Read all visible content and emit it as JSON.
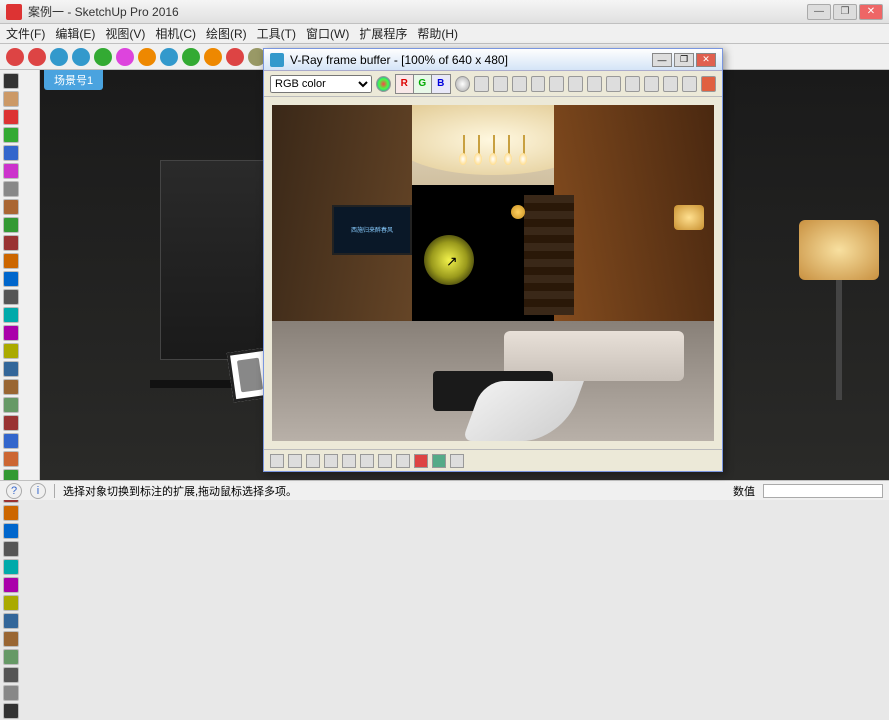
{
  "app": {
    "title": "案例一 - SketchUp Pro 2016",
    "icon_name": "sketchup-icon"
  },
  "window_controls": {
    "min": "—",
    "max": "❐",
    "close": "✕"
  },
  "menus": [
    "文件(F)",
    "编辑(E)",
    "视图(V)",
    "相机(C)",
    "绘图(R)",
    "工具(T)",
    "窗口(W)",
    "扩展程序",
    "帮助(H)"
  ],
  "main_toolbar_colors": [
    "#d44",
    "#d44",
    "#39c",
    "#39c",
    "#3a3",
    "#d4d",
    "#e80",
    "#39c",
    "#3a3",
    "#e80",
    "#d44",
    "#996",
    "#8a5",
    "#8a5",
    "#8a5",
    "#c83",
    "#cc3",
    "#888",
    "#888",
    "#e80",
    "#888",
    "#ec3",
    "#888",
    "#ec3",
    "#888"
  ],
  "scene_tab": "场景号1",
  "vray": {
    "title": "V-Ray frame buffer - [100% of 640 x 480]",
    "channel_selected": "RGB color",
    "channels": [
      "RGB color"
    ],
    "rgb_buttons": {
      "r": "R",
      "g": "G",
      "b": "B"
    },
    "tv_text": "西施归来醉春风"
  },
  "status": {
    "left_icons": [
      "?",
      "i"
    ],
    "hint": "选择对象切换到标注的扩展,拖动鼠标选择多项。",
    "value_label": "数值"
  }
}
